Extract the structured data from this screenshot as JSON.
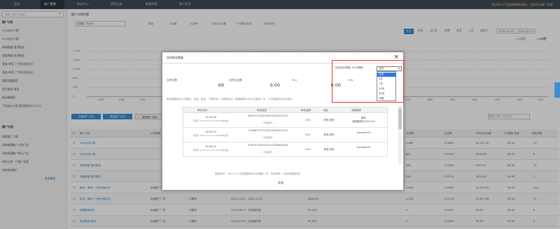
{
  "topbar": {
    "tabs": [
      "首页",
      "推广管理",
      "报告中心",
      "营销工具",
      "数据洞察",
      "账户信息"
    ],
    "active_tab": "推广管理",
    "notice": "关注账户产品数据更新通知，立即开启推广效果"
  },
  "sidebar": {
    "search_placeholder": "请输入推广计划名",
    "items": [
      "推广计划",
      "30%出价人群",
      "50%出价人群",
      "新闻频道-首页推送",
      "频道频道-首页推送",
      "频道-单项（个别分组出价）",
      "频道-单项（个别分组出价）",
      "搜索频道推荐",
      "首页推送-首选",
      "移动端推荐",
      "个别出价人群-首页推送大于11元"
    ],
    "section_title": "推广计划",
    "lower_items": [
      "新版推广人群",
      "如何新建推广计划广告",
      "如何新建推广单元广告",
      "如何上传一个推广创意",
      "如何修改推广"
    ],
    "more": "更多教程"
  },
  "main": {
    "title": "推广计划列表",
    "filter_select": "全部推广计划",
    "legend": [
      "展现",
      "点击数",
      "点击率",
      "平均点击价格",
      "千次展示花费",
      "转化成本"
    ],
    "periods": [
      "今天",
      "昨天",
      "近7天",
      "本周",
      "本月",
      "上月",
      "自定义"
    ],
    "date_range": "2015-10-23 ~ 2015-10-23",
    "right_legend": [
      "1/4消费",
      "1/4消费"
    ],
    "y_ticks": [
      "2,000",
      "1,600",
      "1,200",
      "800",
      "400",
      "0"
    ],
    "x_ticks": [
      "00时",
      "01时",
      "02时",
      "03时",
      "04时",
      "05时",
      "17时",
      "18时",
      "19时",
      "20时",
      "21时",
      "22时",
      "23时"
    ],
    "buttons": [
      "新建推广计划",
      "批量推广计划",
      "更改推广状态"
    ],
    "search_placeholder": "请输入推广计划名称",
    "columns": [
      "推广计划",
      "计划类型",
      "状态",
      "创建时间",
      "每日预算",
      "点击数",
      "点击率",
      "平均点击价格",
      "千次展示花费",
      "消费",
      "转化成本",
      "转化次数"
    ],
    "rows": [
      {
        "name": "30%出价人群",
        "type": "",
        "status": "",
        "date": "",
        "budget": "",
        "v1": "2,689",
        "v2": "0.965%",
        "v3": "¥1,471.70",
        "v4": "¥0.31",
        "v5": "23"
      },
      {
        "name": "50%出价人群",
        "type": "",
        "status": "",
        "date": "",
        "budget": "",
        "v1": "801",
        "v2": "0.251%",
        "v3": "¥247.84",
        "v4": "¥0.31",
        "v5": "8"
      },
      {
        "name": "新闻频道-首页推送",
        "type": "",
        "status": "",
        "date": "",
        "budget": "",
        "v1": "636",
        "v2": "0.354%",
        "v3": "¥321.42",
        "v4": "¥0.49",
        "v5": "23"
      },
      {
        "name": "频道频道-首页推送",
        "type": "",
        "status": "",
        "date": "",
        "budget": "",
        "v1": "341",
        "v2": "0.327%",
        "v3": "¥223.04",
        "v4": "¥0.65",
        "v5": "7"
      },
      {
        "name": "首页 - 单项（个别分组出价）",
        "type": "标准推广广告",
        "status": "",
        "date": "",
        "budget": "",
        "v1": "3,640",
        "v2": "0.456%",
        "v3": "¥1,014.52",
        "v4": "¥0.43",
        "v5": "114"
      },
      {
        "name": "首页 - 单项（个别分组出价）",
        "type": "标准推广广告",
        "status": "已暂停",
        "date": "2015-10-07 - 2015-12-31",
        "budget": "¥68,000",
        "v1": "4,142",
        "v2": "0.511%",
        "v3": "¥1,871.36",
        "v4": "¥0.44",
        "v5": "91"
      },
      {
        "name": "频道推荐首页",
        "type": "标准推广广告",
        "status": "已暂停",
        "date": "2015-08-29 - 无结束时间",
        "budget": "¥1,000",
        "v1": "0",
        "v2": "0.000%",
        "v3": "¥0.00",
        "v4": "¥0.00",
        "v5": "0"
      },
      {
        "name": "首页推送-首选",
        "type": "标准推广广告",
        "status": "已暂停",
        "date": "2015-07-22 - 无结束时间",
        "budget": "¥2,000",
        "v1": "0",
        "v2": "0.000%",
        "v3": "¥0.00",
        "v4": "¥0.00",
        "v5": "0"
      },
      {
        "name": "移动推荐-首页",
        "type": "标准推广广告",
        "status": "已暂停",
        "date": "2015-06-10 - 无结束时间",
        "budget": "¥3,000",
        "v1": "0",
        "v2": "0.000%",
        "v3": "¥0.00",
        "v4": "¥0.00",
        "v5": "0"
      }
    ]
  },
  "modal": {
    "title": "实时转化数据",
    "close": "×",
    "metrics": [
      {
        "label": "总转化数",
        "value": "69"
      },
      {
        "label": "总转化金额",
        "value": "0.00"
      },
      {
        "label": "ROI",
        "value": "0.00"
      },
      {
        "label": "CPA",
        "value": ""
      }
    ],
    "window_label": "转化回环周期（ROI周期）",
    "window_selected": "当日",
    "window_options": [
      "当日",
      "1天",
      "7天",
      "15天",
      "30天",
      "不限"
    ],
    "window_link": "什么是转化周期？",
    "description": "转化数据每半小时更新，注册、激活、下载完成、付款等成功、数据每隔30秒左右更新一次，以下数据均为实时统计",
    "columns": [
      "转化时间",
      "转化信息",
      "转化金额",
      "地区",
      "来源媒体"
    ],
    "rows": [
      {
        "time": "16:03:06",
        "time_sub": "来源于 2015-10-23 14:06:34的点击",
        "info": "0854741374067962144558732319",
        "info_sub": "（订单编号）",
        "amount": "0.00",
        "region": "其他-其他",
        "media": "腾讯",
        "media_sub": "视频播放页300x250"
      },
      {
        "time": "16:00:25",
        "time_sub": "来源于 2015-10-23 13:06:45的点击",
        "info": "7149667913757287144558722452",
        "info_sub": "（订单编号）",
        "amount": "0.00",
        "region": "其他-其他",
        "media": "GoogleADX",
        "media_sub": ""
      },
      {
        "time": "15:46:43",
        "time_sub": "来源于 2015-10-23 15:36:10的点击",
        "info": "5538757262042811445586602456",
        "info_sub": "（订单编号）",
        "amount": "0.00",
        "region": "其他-其他",
        "media": "GoogleADX",
        "media_sub": ""
      }
    ],
    "footer": "更新时间：16:07:51  实时数据每半分钟更新一次，仅供参考，以实际数据为准",
    "close_button": "关闭"
  }
}
